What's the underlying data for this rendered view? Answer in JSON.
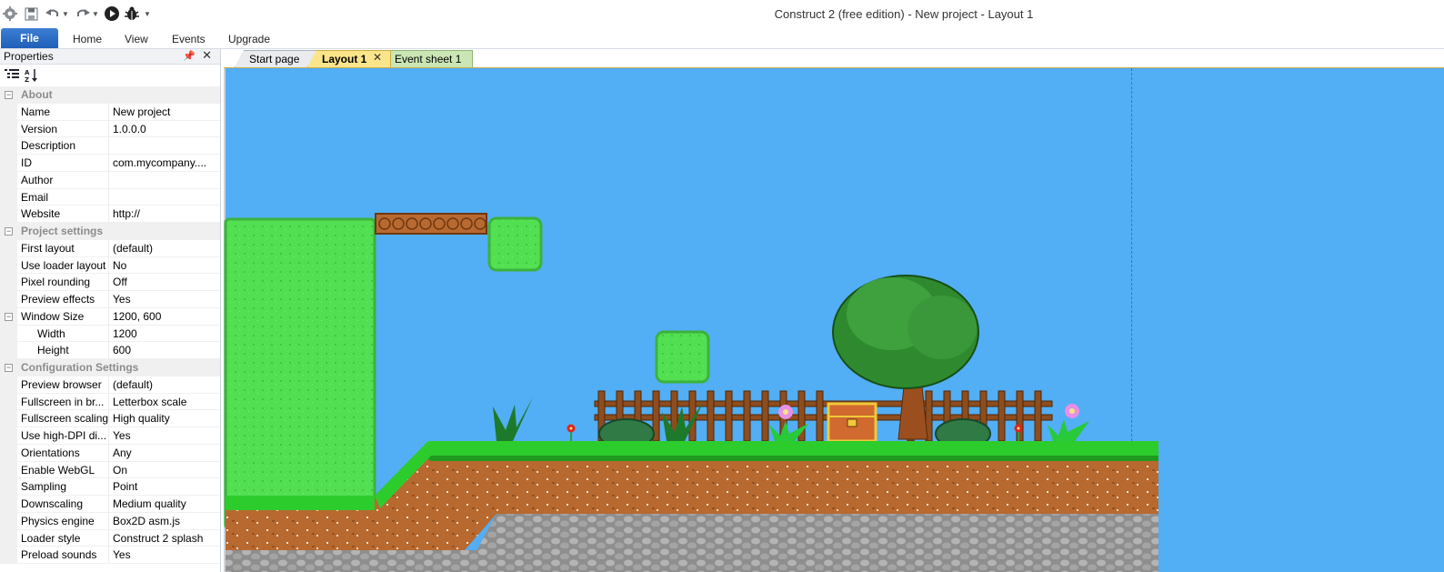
{
  "window": {
    "title": "Construct 2  (free edition) - New project - Layout 1",
    "quick_access": [
      "app-gear-icon",
      "save-icon",
      "undo-icon",
      "undo-dropdown-icon",
      "redo-icon",
      "redo-dropdown-icon",
      "run-layout-icon",
      "debug-bug-icon",
      "customize-dropdown-icon"
    ]
  },
  "ribbon": {
    "file": "File",
    "tabs": [
      "Home",
      "View",
      "Events",
      "Upgrade"
    ]
  },
  "properties": {
    "title": "Properties",
    "tools": [
      "categorized-icon",
      "alphabetical-icon"
    ],
    "rows": [
      {
        "type": "cat",
        "label": "About"
      },
      {
        "type": "prop",
        "key": "Name",
        "value": "New project"
      },
      {
        "type": "prop",
        "key": "Version",
        "value": "1.0.0.0"
      },
      {
        "type": "prop",
        "key": "Description",
        "value": ""
      },
      {
        "type": "prop",
        "key": "ID",
        "value": "com.mycompany...."
      },
      {
        "type": "prop",
        "key": "Author",
        "value": ""
      },
      {
        "type": "prop",
        "key": "Email",
        "value": ""
      },
      {
        "type": "prop",
        "key": "Website",
        "value": "http://"
      },
      {
        "type": "cat",
        "label": "Project settings"
      },
      {
        "type": "prop",
        "key": "First layout",
        "value": "(default)"
      },
      {
        "type": "prop",
        "key": "Use loader layout",
        "value": "No"
      },
      {
        "type": "prop",
        "key": "Pixel rounding",
        "value": "Off"
      },
      {
        "type": "prop",
        "key": "Preview effects",
        "value": "Yes"
      },
      {
        "type": "group",
        "key": "Window Size",
        "value": "1200, 600"
      },
      {
        "type": "sub",
        "key": "Width",
        "value": "1200"
      },
      {
        "type": "sub",
        "key": "Height",
        "value": "600"
      },
      {
        "type": "cat",
        "label": "Configuration Settings"
      },
      {
        "type": "prop",
        "key": "Preview browser",
        "value": "(default)"
      },
      {
        "type": "prop",
        "key": "Fullscreen in br...",
        "value": "Letterbox scale"
      },
      {
        "type": "prop",
        "key": "Fullscreen scaling",
        "value": "High quality"
      },
      {
        "type": "prop",
        "key": "Use high-DPI di...",
        "value": "Yes"
      },
      {
        "type": "prop",
        "key": "Orientations",
        "value": "Any"
      },
      {
        "type": "prop",
        "key": "Enable WebGL",
        "value": "On"
      },
      {
        "type": "prop",
        "key": "Sampling",
        "value": "Point"
      },
      {
        "type": "prop",
        "key": "Downscaling",
        "value": "Medium quality"
      },
      {
        "type": "prop",
        "key": "Physics engine",
        "value": "Box2D asm.js"
      },
      {
        "type": "prop",
        "key": "Loader style",
        "value": "Construct 2 splash"
      },
      {
        "type": "prop",
        "key": "Preload sounds",
        "value": "Yes"
      }
    ]
  },
  "doc_tabs": [
    {
      "id": "tab-start",
      "label": "Start page"
    },
    {
      "id": "tab-layout",
      "label": "Layout 1"
    },
    {
      "id": "tab-event",
      "label": "Event sheet 1"
    }
  ],
  "layout": {
    "background": "#52aef5",
    "objects": [
      "grass-column-tile",
      "log-bridge",
      "floating-grass-block",
      "floating-grass-block",
      "wooden-fence",
      "tree",
      "treasure-chest",
      "bush",
      "bush",
      "grass-tuft",
      "grass-tuft",
      "pink-flower",
      "pink-flower",
      "red-flower",
      "red-flower",
      "ground-slope",
      "ground-platform",
      "stone-layer"
    ]
  }
}
